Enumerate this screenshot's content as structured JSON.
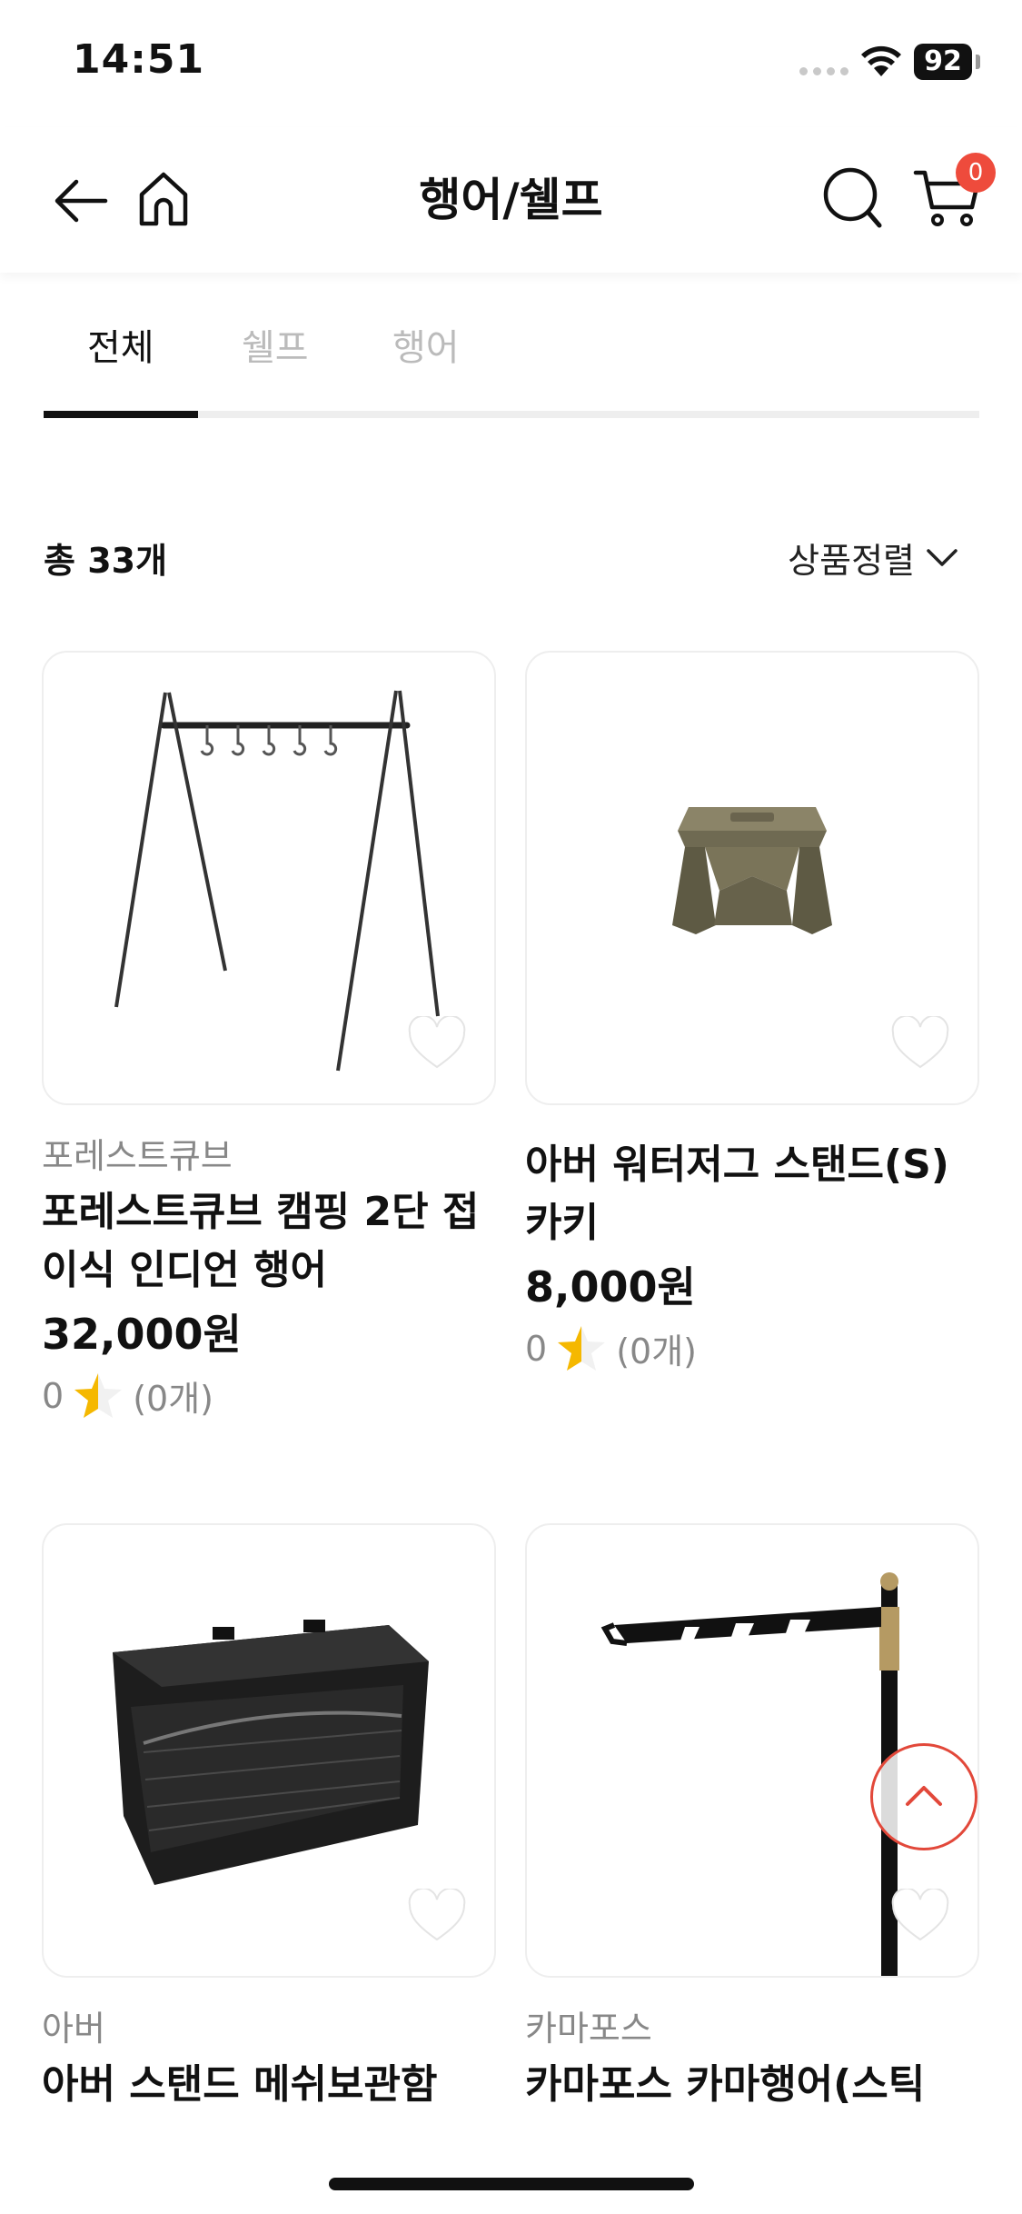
{
  "status_bar": {
    "time": "14:51",
    "battery": "92"
  },
  "header": {
    "title": "행어/쉘프",
    "cart_count": "0"
  },
  "tabs": [
    {
      "label": "전체",
      "active": true
    },
    {
      "label": "쉘프",
      "active": false
    },
    {
      "label": "행어",
      "active": false
    }
  ],
  "list": {
    "count_label": "총 33개",
    "sort_label": "상품정렬"
  },
  "products": [
    {
      "brand": "포레스트큐브",
      "name": "포레스트큐브 캠핑 2단 접이식 인디언 행어",
      "price": "32,000원",
      "rating": "0",
      "review_count": "(0개)"
    },
    {
      "brand": "",
      "name": "아버 워터저그 스탠드(S) 카키",
      "price": "8,000원",
      "rating": "0",
      "review_count": "(0개)"
    },
    {
      "brand": "아버",
      "name": "아버 스탠드 메쉬보관함",
      "price": "",
      "rating": "",
      "review_count": ""
    },
    {
      "brand": "카마포스",
      "name": "카마포스 카마행어(스틱",
      "price": "",
      "rating": "",
      "review_count": ""
    }
  ],
  "colors": {
    "accent": "#ee4b3c",
    "star": "#f5b800",
    "muted": "#888888"
  }
}
